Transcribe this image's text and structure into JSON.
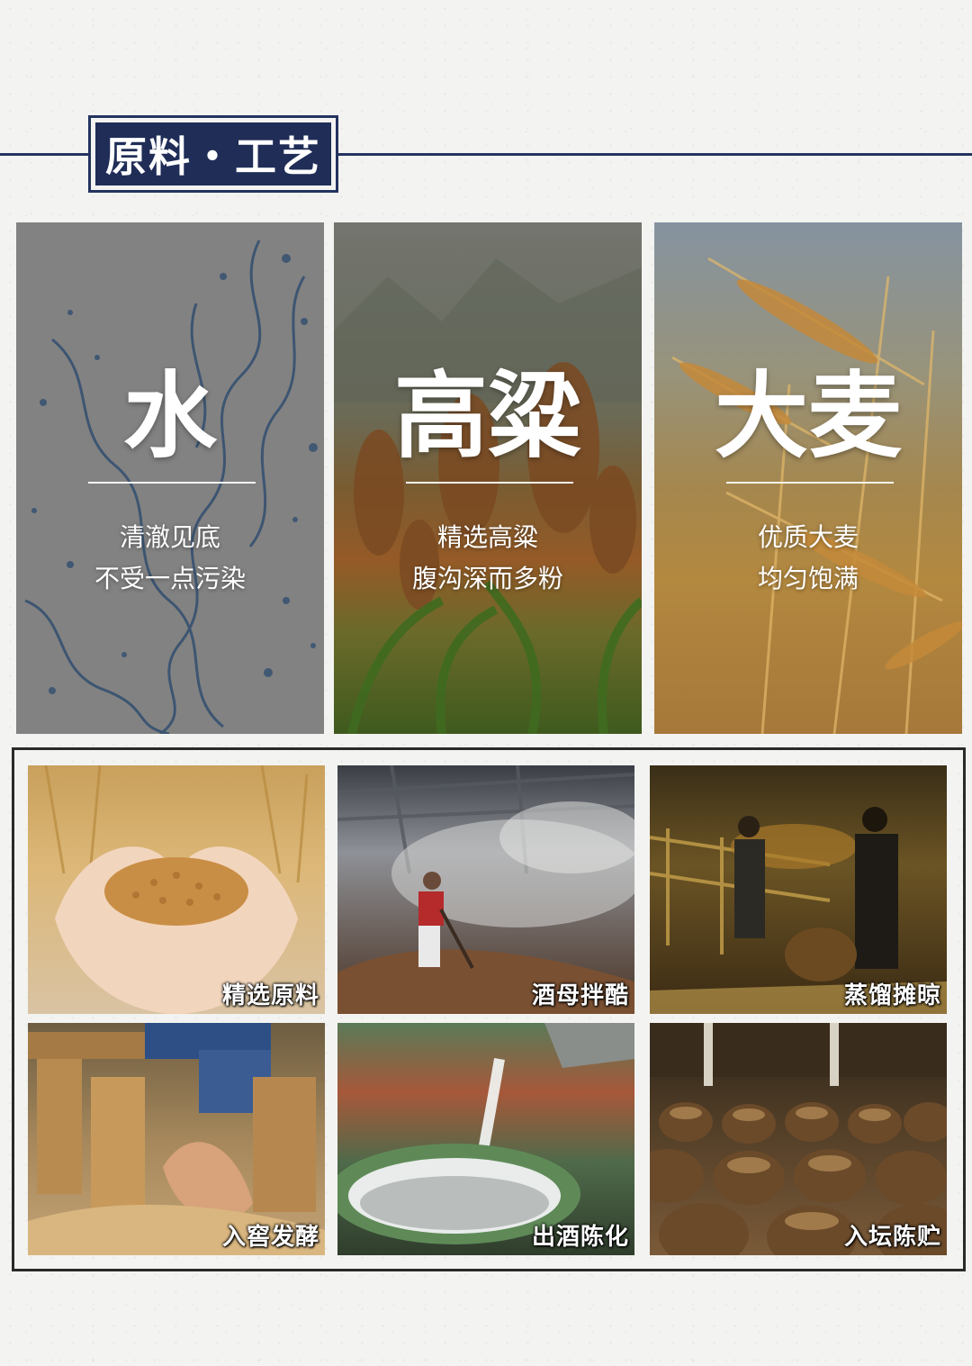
{
  "section": {
    "title": "原料・工艺"
  },
  "ingredients": [
    {
      "name": "水",
      "line1": "清澈见底",
      "line2": "不受一点污染",
      "icon": "water-splash"
    },
    {
      "name": "高粱",
      "line1": "精选高粱",
      "line2": "腹沟深而多粉",
      "icon": "sorghum"
    },
    {
      "name": "大麦",
      "line1": "优质大麦",
      "line2": "均匀饱满",
      "icon": "barley"
    }
  ],
  "process": [
    {
      "label": "精选原料",
      "icon": "grain-in-hands"
    },
    {
      "label": "酒母拌酷",
      "icon": "workshop-steam"
    },
    {
      "label": "蒸馏摊晾",
      "icon": "distillery-workers"
    },
    {
      "label": "入窖发酵",
      "icon": "qu-bricks"
    },
    {
      "label": "出酒陈化",
      "icon": "pouring-liquor"
    },
    {
      "label": "入坛陈贮",
      "icon": "storage-jars"
    }
  ]
}
